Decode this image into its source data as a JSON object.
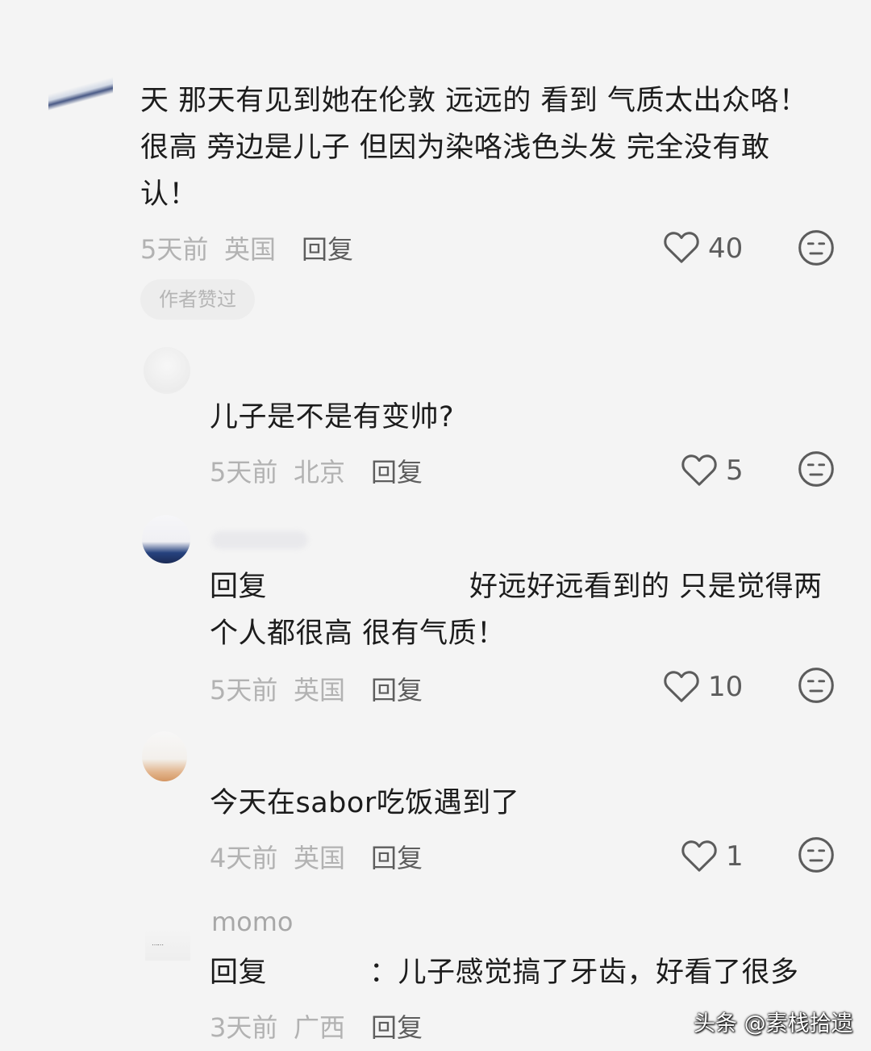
{
  "comments": [
    {
      "lines": [
        "天 那天有见到她在伦敦 远远的 看到 气质太出众咯！",
        "很高 旁边是儿子 但因为染咯浅色头发 完全没有敢",
        "认！"
      ],
      "time": "5天前",
      "location": "英国",
      "reply_label": "回复",
      "likes": "40",
      "badge": "作者赞过"
    }
  ],
  "replies": [
    {
      "lines": [
        "儿子是不是有变帅?"
      ],
      "time": "5天前",
      "location": "北京",
      "reply_label": "回复",
      "likes": "5"
    },
    {
      "prefix": "回复",
      "lines": [
        "好远好远看到的 只是觉得两",
        "个人都很高 很有气质！"
      ],
      "time": "5天前",
      "location": "英国",
      "reply_label": "回复",
      "likes": "10"
    },
    {
      "lines": [
        "今天在sabor吃饭遇到了"
      ],
      "time": "4天前",
      "location": "英国",
      "reply_label": "回复",
      "likes": "1"
    },
    {
      "author_fragment": "momo",
      "prefix": "回复",
      "lines": [
        "：儿子感觉搞了牙齿，好看了很多"
      ],
      "time": "3天前",
      "location": "广西",
      "reply_label": "回复"
    }
  ],
  "watermark": "头条 @素栈拾遗",
  "colors": {
    "background": "#f4f4f4",
    "text": "#1c1c1c",
    "meta": "#b2b2b2",
    "icon": "#5c5c5c"
  },
  "icons": {
    "like": "heart-outline",
    "react": "neutral-face"
  }
}
